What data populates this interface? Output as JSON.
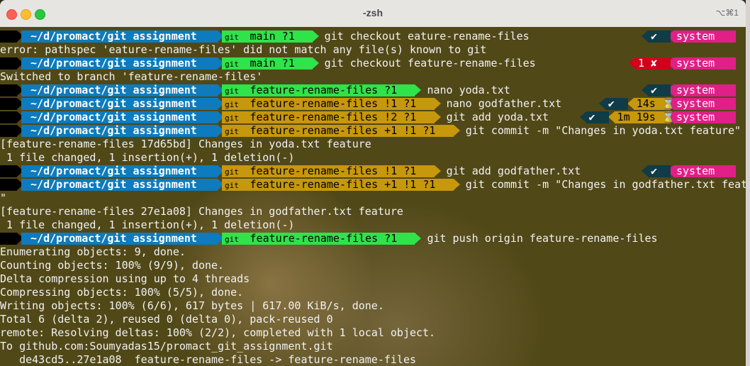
{
  "window": {
    "title": "-zsh",
    "shortcut": "⌥⌘1"
  },
  "prompt": {
    "dir": "~/d/promact/git assignment",
    "system": "system",
    "ok": "✔",
    "icons": {
      "apple": "",
      "folder": "",
      "branch": "",
      "home": "",
      "git": "git",
      "hourglass": "⌛"
    }
  },
  "lines": [
    {
      "type": "prompt",
      "git": "green",
      "branch": "main ?1",
      "command": "git checkout eature-rename-files",
      "status": "ok"
    },
    {
      "type": "out",
      "text": "error: pathspec 'eature-rename-files' did not match any file(s) known to git"
    },
    {
      "type": "prompt",
      "git": "green",
      "branch": "main ?1",
      "command": "git checkout feature-rename-files",
      "status": "err",
      "code": "1 ✘"
    },
    {
      "type": "out",
      "text": "Switched to branch 'feature-rename-files'"
    },
    {
      "type": "prompt",
      "git": "green",
      "branch": "feature-rename-files ?1",
      "command": "nano yoda.txt",
      "status": "ok"
    },
    {
      "type": "prompt",
      "git": "yellow",
      "branch": "feature-rename-files !1 ?1",
      "command": "nano godfather.txt",
      "status": "time",
      "time": "14s"
    },
    {
      "type": "prompt",
      "git": "yellow",
      "branch": "feature-rename-files !2 ?1",
      "command": "git add yoda.txt",
      "status": "time",
      "time": "1m 19s"
    },
    {
      "type": "prompt",
      "git": "yellow",
      "branch": "feature-rename-files +1 !1 ?1",
      "command": "git commit -m \"Changes in yoda.txt feature\"",
      "status": "none"
    },
    {
      "type": "out",
      "text": "[feature-rename-files 17d65bd] Changes in yoda.txt feature"
    },
    {
      "type": "out",
      "text": " 1 file changed, 1 insertion(+), 1 deletion(-)"
    },
    {
      "type": "prompt",
      "git": "yellow",
      "branch": "feature-rename-files !1 ?1",
      "command": "git add godfather.txt",
      "status": "ok"
    },
    {
      "type": "prompt",
      "git": "yellow",
      "branch": "feature-rename-files +1 !1 ?1",
      "command": "git commit -m \"Changes in godfather.txt feature",
      "status": "none"
    },
    {
      "type": "out",
      "text": "\""
    },
    {
      "type": "out",
      "text": "[feature-rename-files 27e1a08] Changes in godfather.txt feature"
    },
    {
      "type": "out",
      "text": " 1 file changed, 1 insertion(+), 1 deletion(-)"
    },
    {
      "type": "prompt",
      "git": "green",
      "branch": "feature-rename-files ?1",
      "command": "git push origin feature-rename-files",
      "status": "none"
    },
    {
      "type": "out",
      "text": "Enumerating objects: 9, done."
    },
    {
      "type": "out",
      "text": "Counting objects: 100% (9/9), done."
    },
    {
      "type": "out",
      "text": "Delta compression using up to 4 threads"
    },
    {
      "type": "out",
      "text": "Compressing objects: 100% (5/5), done."
    },
    {
      "type": "out",
      "text": "Writing objects: 100% (6/6), 617 bytes | 617.00 KiB/s, done."
    },
    {
      "type": "out",
      "text": "Total 6 (delta 2), reused 0 (delta 0), pack-reused 0"
    },
    {
      "type": "out",
      "text": "remote: Resolving deltas: 100% (2/2), completed with 1 local object."
    },
    {
      "type": "out",
      "text": "To github.com:Soumyadas15/promact_git_assignment.git"
    },
    {
      "type": "out",
      "text": "   de43cd5..27e1a08  feature-rename-files -> feature-rename-files"
    }
  ]
}
